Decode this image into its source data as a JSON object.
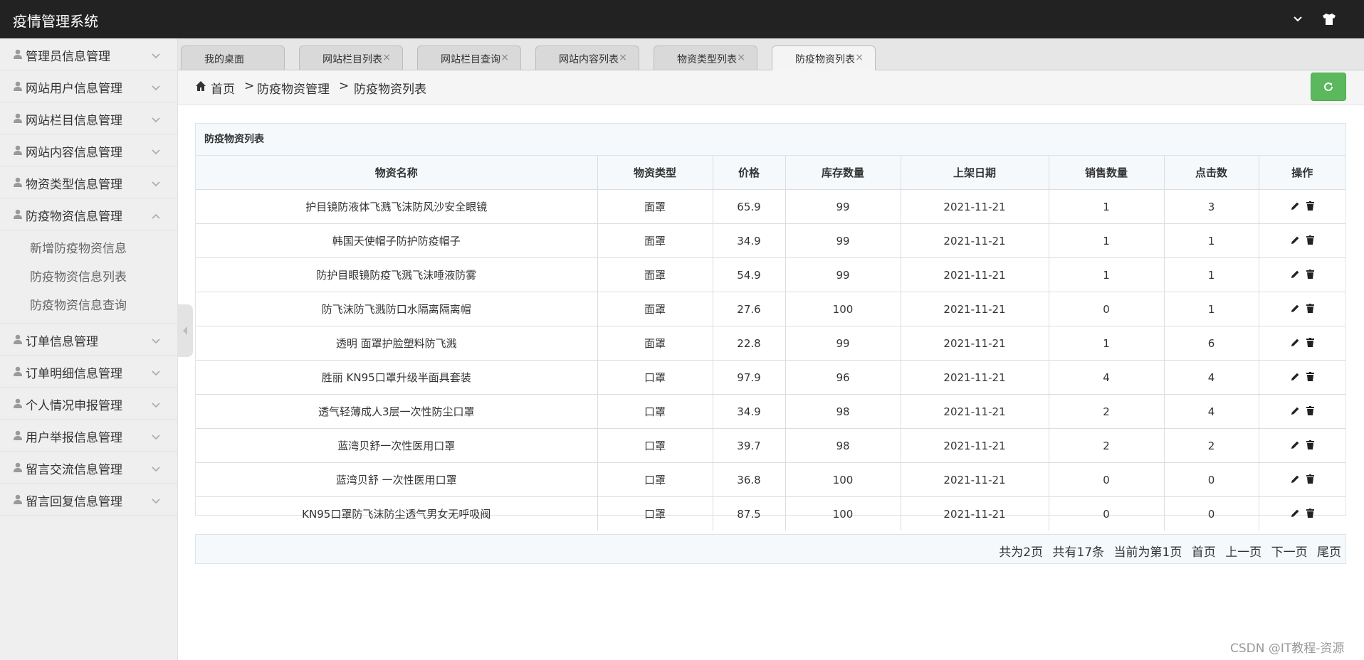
{
  "app": {
    "title": "疫情管理系统",
    "header_icons": [
      "chevron-down-icon",
      "tshirt-icon"
    ]
  },
  "sidebar": {
    "groups": [
      {
        "label": "管理员信息管理",
        "expanded": false
      },
      {
        "label": "网站用户信息管理",
        "expanded": false
      },
      {
        "label": "网站栏目信息管理",
        "expanded": false
      },
      {
        "label": "网站内容信息管理",
        "expanded": false
      },
      {
        "label": "物资类型信息管理",
        "expanded": false
      },
      {
        "label": "防疫物资信息管理",
        "expanded": true,
        "sub_items": [
          "新增防疫物资信息",
          "防疫物资信息列表",
          "防疫物资信息查询"
        ]
      },
      {
        "label": "订单信息管理",
        "expanded": false
      },
      {
        "label": "订单明细信息管理",
        "expanded": false
      },
      {
        "label": "个人情况申报管理",
        "expanded": false
      },
      {
        "label": "用户举报信息管理",
        "expanded": false
      },
      {
        "label": "留言交流信息管理",
        "expanded": false
      },
      {
        "label": "留言回复信息管理",
        "expanded": false
      }
    ]
  },
  "tabs": [
    {
      "label": "我的桌面",
      "closable": false,
      "active": false
    },
    {
      "label": "网站栏目列表",
      "closable": true,
      "active": false
    },
    {
      "label": "网站栏目查询",
      "closable": true,
      "active": false
    },
    {
      "label": "网站内容列表",
      "closable": true,
      "active": false
    },
    {
      "label": "物资类型列表",
      "closable": true,
      "active": false
    },
    {
      "label": "防疫物资列表",
      "closable": true,
      "active": true
    }
  ],
  "tab_close_glyph": "×",
  "breadcrumb": {
    "home": "首页",
    "separator": ">",
    "level1": "防疫物资管理",
    "level2": "防疫物资列表"
  },
  "table": {
    "caption": "防疫物资列表",
    "columns": [
      "物资名称",
      "物资类型",
      "价格",
      "库存数量",
      "上架日期",
      "销售数量",
      "点击数",
      "操作"
    ],
    "rows": [
      [
        "护目镜防液体飞溅飞沫防风沙安全眼镜",
        "面罩",
        "65.9",
        "99",
        "2021-11-21",
        "1",
        "3"
      ],
      [
        "韩国天使帽子防护防疫帽子",
        "面罩",
        "34.9",
        "99",
        "2021-11-21",
        "1",
        "1"
      ],
      [
        "防护目眼镜防疫飞溅飞沫唾液防雾",
        "面罩",
        "54.9",
        "99",
        "2021-11-21",
        "1",
        "1"
      ],
      [
        "防飞沫防飞溅防口水隔离隔离帽",
        "面罩",
        "27.6",
        "100",
        "2021-11-21",
        "0",
        "1"
      ],
      [
        "透明 面罩护脸塑料防飞溅",
        "面罩",
        "22.8",
        "99",
        "2021-11-21",
        "1",
        "6"
      ],
      [
        "胜丽 KN95口罩升级半面具套装",
        "口罩",
        "97.9",
        "96",
        "2021-11-21",
        "4",
        "4"
      ],
      [
        "透气轻薄成人3层一次性防尘口罩",
        "口罩",
        "34.9",
        "98",
        "2021-11-21",
        "2",
        "4"
      ],
      [
        "蓝湾贝舒一次性医用口罩",
        "口罩",
        "39.7",
        "98",
        "2021-11-21",
        "2",
        "2"
      ],
      [
        "蓝湾贝舒 一次性医用口罩",
        "口罩",
        "36.8",
        "100",
        "2021-11-21",
        "0",
        "0"
      ],
      [
        "KN95口罩防飞沫防尘透气男女无呼吸阀",
        "口罩",
        "87.5",
        "100",
        "2021-11-21",
        "0",
        "0"
      ]
    ],
    "row_actions": [
      "edit-icon",
      "delete-icon"
    ]
  },
  "pager": {
    "total_pages": "共为2页",
    "total_records": "共有17条",
    "current": "当前为第1页",
    "first": "首页",
    "prev": "上一页",
    "next": "下一页",
    "last": "尾页"
  },
  "watermark": "CSDN @IT教程-资源",
  "colors": {
    "topbar": "#222222",
    "sidebar": "#efefef",
    "refresh_button": "#5cb85c",
    "panel_header": "#f5f9fc"
  }
}
